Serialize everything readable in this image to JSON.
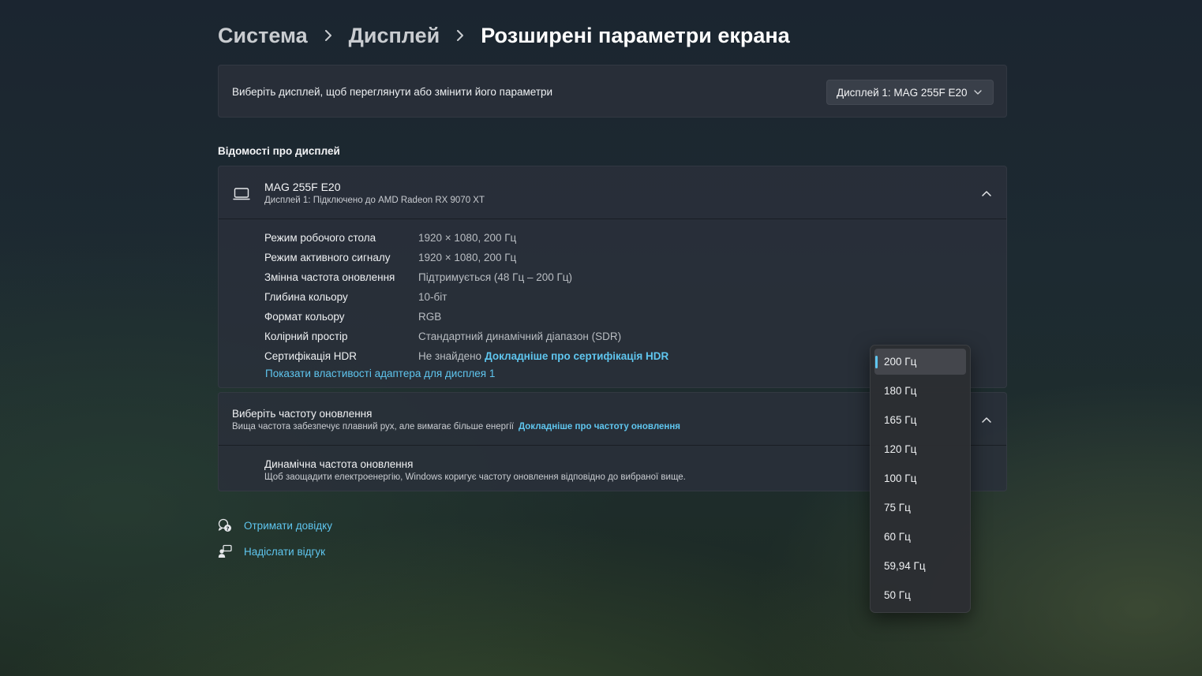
{
  "breadcrumb": {
    "items": [
      "Система",
      "Дисплей"
    ],
    "current": "Розширені параметри екрана"
  },
  "display_select": {
    "label": "Виберіть дисплей, щоб переглянути або змінити його параметри",
    "selected": "Дисплей 1: MAG 255F E20"
  },
  "display_info": {
    "section_title": "Відомості про дисплей",
    "name": "MAG 255F E20",
    "subtitle": "Дисплей 1: Підключено до AMD Radeon RX 9070 XT",
    "rows": [
      {
        "key": "Режим робочого стола",
        "value": "1920 × 1080, 200 Гц"
      },
      {
        "key": "Режим активного сигналу",
        "value": "1920 × 1080, 200 Гц"
      },
      {
        "key": "Змінна частота оновлення",
        "value": "Підтримується (48 Гц – 200 Гц)"
      },
      {
        "key": "Глибина кольору",
        "value": "10-біт"
      },
      {
        "key": "Формат кольору",
        "value": "RGB"
      },
      {
        "key": "Колірний простір",
        "value": "Стандартний динамічний діапазон (SDR)"
      },
      {
        "key": "Сертифікація HDR",
        "value": "Не знайдено"
      }
    ],
    "hdr_link": "Докладніше про сертифікація HDR",
    "adapter_link": "Показати властивості адаптера для дисплея 1"
  },
  "refresh": {
    "title": "Виберіть частоту оновлення",
    "subtitle": "Вища частота забезпечує плавний рух, але вимагає більше енергії",
    "link": "Докладніше про частоту оновлення",
    "dynamic_title": "Динамічна частота оновлення",
    "dynamic_subtitle": "Щоб заощадити електроенергію, Windows коригує частоту оновлення відповідно до вибраної вище.",
    "options": [
      "200 Гц",
      "180 Гц",
      "165 Гц",
      "120 Гц",
      "100 Гц",
      "75 Гц",
      "60 Гц",
      "59,94 Гц",
      "50 Гц"
    ],
    "selected": "200 Гц"
  },
  "footer": {
    "help": "Отримати довідку",
    "feedback": "Надіслати відгук"
  },
  "colors": {
    "accent": "#5fc6ef",
    "card": "#2a303a"
  },
  "icons": {
    "monitor": "monitor-icon",
    "help": "help-chat-icon",
    "feedback": "feedback-person-icon",
    "chevron": "chevron-icon"
  }
}
